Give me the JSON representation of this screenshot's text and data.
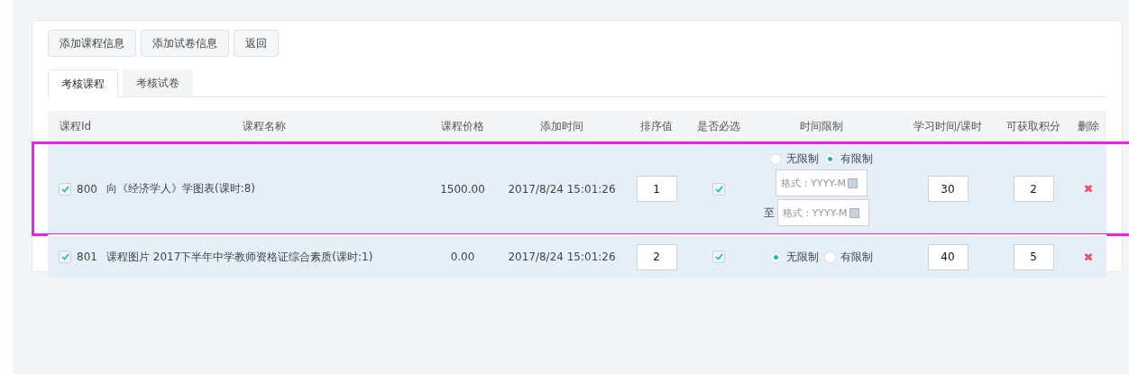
{
  "toolbar": {
    "buttons": [
      "添加课程信息",
      "添加试卷信息",
      "返回"
    ]
  },
  "tabs": [
    {
      "label": "考核课程",
      "selected": true
    },
    {
      "label": "考核试卷",
      "selected": false
    }
  ],
  "table": {
    "columns": [
      "课程Id",
      "课程名称",
      "课程价格",
      "添加时间",
      "排序值",
      "是否必选",
      "时间限制",
      "学习时间/课时",
      "可获取积分",
      "删除"
    ],
    "rows": [
      {
        "highlighted": true,
        "checked": true,
        "id": "800",
        "name": "向《经济学人》学图表(课时:8)",
        "price": "1500.00",
        "added": "2017/8/24 15:01:26",
        "sort": "1",
        "required": true,
        "limit_options": [
          {
            "label": "无限制",
            "selected": false
          },
          {
            "label": "有限制",
            "selected": true
          }
        ],
        "date_from_placeholder": "格式：YYYY-M",
        "range_separator": "至",
        "date_to_placeholder": "格式：YYYY-M",
        "study_time": "30",
        "points": "2",
        "delete_icon": "✖"
      },
      {
        "highlighted": false,
        "checked": true,
        "id": "801",
        "name": "课程图片 2017下半年中学教师资格证综合素质(课时:1)",
        "price": "0.00",
        "added": "2017/8/24 15:01:26",
        "sort": "2",
        "required": true,
        "limit_options": [
          {
            "label": "无限制",
            "selected": true
          },
          {
            "label": "有限制",
            "selected": false
          }
        ],
        "study_time": "40",
        "points": "5",
        "delete_icon": "✖"
      }
    ]
  }
}
